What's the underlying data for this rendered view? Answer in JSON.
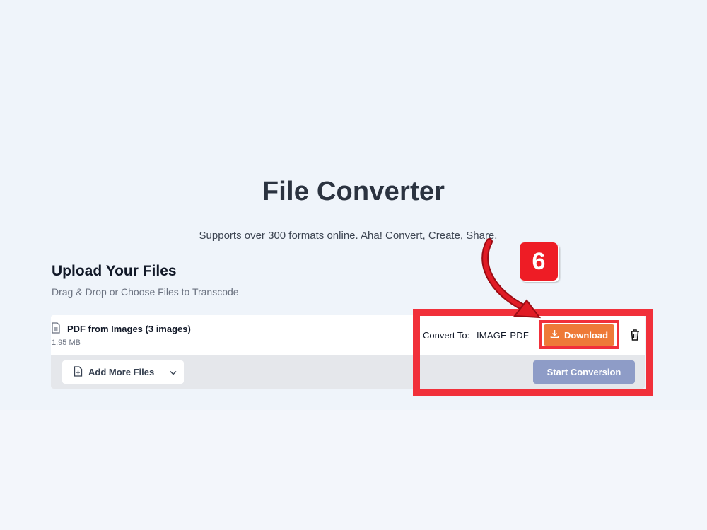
{
  "header": {
    "title": "File Converter",
    "subtitle": "Supports over 300 formats online. Aha! Convert, Create, Share."
  },
  "upload": {
    "title": "Upload Your Files",
    "subtitle": "Drag & Drop or Choose Files to Transcode"
  },
  "file": {
    "name": "PDF from Images (3 images)",
    "size": "1.95 MB",
    "convert_label": "Convert To:",
    "convert_value": "IMAGE-PDF",
    "download_label": "Download"
  },
  "actions": {
    "add_more_label": "Add More Files",
    "start_label": "Start Conversion"
  },
  "annotation": {
    "step_number": "6",
    "highlight_color": "#f1303a"
  },
  "colors": {
    "download": "#ee7a38",
    "start_conversion": "#8e9cc7"
  }
}
